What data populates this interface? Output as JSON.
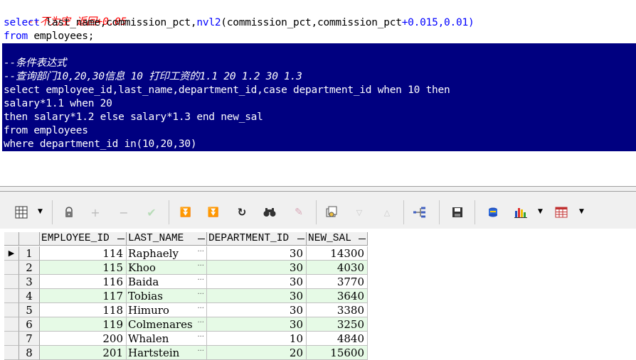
{
  "editor": {
    "line1": "--不为空 返回+0.05",
    "line2_kw": "select",
    "line2_a": " last_name,commission_pct,",
    "line2_fn": "nvl2",
    "line2_b": "(commission_pct,commission_pct",
    "line2_c": "+0.015,0.01)",
    "line3_kw": "from",
    "line3_a": " employees;",
    "selected": [
      "--条件表达式",
      "--查询部门10,20,30信息 10 打印工资的1.1 20 1.2 30 1.3",
      "select employee_id,last_name,department_id,case department_id when 10 then",
      "salary*1.1 when 20",
      "then salary*1.2 else salary*1.3 end new_sal",
      "from employees",
      "where department_id in(10,20,30)"
    ]
  },
  "toolbar": {
    "icons": [
      "grid-view-icon",
      "lock-icon",
      "add-icon",
      "remove-icon",
      "check-icon",
      "filter-down-icon",
      "filter-icon",
      "refresh-icon",
      "find-icon",
      "clear-icon",
      "query-icon",
      "arrow-down-icon",
      "arrow-up-icon",
      "tree-icon",
      "save-icon",
      "database-icon",
      "chart-icon",
      "table-icon"
    ]
  },
  "grid": {
    "columns": [
      "EMPLOYEE_ID",
      "LAST_NAME",
      "DEPARTMENT_ID",
      "NEW_SAL"
    ],
    "rows": [
      {
        "n": "1",
        "employee_id": "114",
        "last_name": "Raphaely",
        "department_id": "30",
        "new_sal": "14300"
      },
      {
        "n": "2",
        "employee_id": "115",
        "last_name": "Khoo",
        "department_id": "30",
        "new_sal": "4030"
      },
      {
        "n": "3",
        "employee_id": "116",
        "last_name": "Baida",
        "department_id": "30",
        "new_sal": "3770"
      },
      {
        "n": "4",
        "employee_id": "117",
        "last_name": "Tobias",
        "department_id": "30",
        "new_sal": "3640"
      },
      {
        "n": "5",
        "employee_id": "118",
        "last_name": "Himuro",
        "department_id": "30",
        "new_sal": "3380"
      },
      {
        "n": "6",
        "employee_id": "119",
        "last_name": "Colmenares",
        "department_id": "30",
        "new_sal": "3250"
      },
      {
        "n": "7",
        "employee_id": "200",
        "last_name": "Whalen",
        "department_id": "10",
        "new_sal": "4840"
      },
      {
        "n": "8",
        "employee_id": "201",
        "last_name": "Hartstein",
        "department_id": "20",
        "new_sal": "15600"
      }
    ],
    "current_row_marker": "▶",
    "even_row_color": "#e6fae6"
  }
}
